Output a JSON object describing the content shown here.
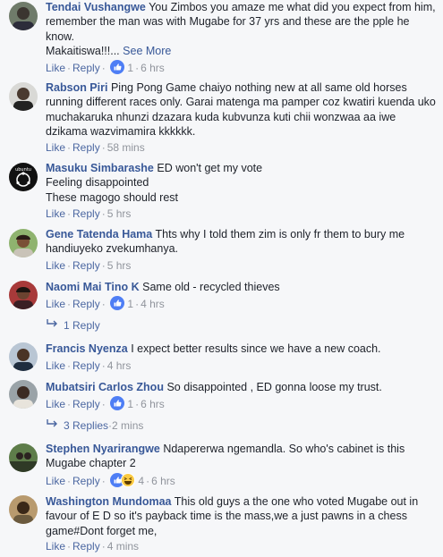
{
  "actions": {
    "like": "Like",
    "reply": "Reply",
    "sep": "·",
    "see_more": "See More"
  },
  "comments": [
    {
      "author": "Tendai Vushangwe",
      "text": "You Zimbos you amaze me what did you expect from him, remember the man was with Mugabe for 37 yrs and these are the pple he know.",
      "text2": "Makaitiswa!!!...",
      "reaction_count": "1",
      "time": "6 hrs",
      "avatar_icon": "photo-avatar-icon"
    },
    {
      "author": "Rabson Piri",
      "text": "Ping Pong Game chaiyo nothing new at all same old horses running different races only. Garai matenga ma pamper coz kwatiri kuenda uko muchakaruka nhunzi dzazara kuda kubvunza kuti chii wonzwaa aa iwe dzikama wazvimamira kkkkkk.",
      "time": "58 mins",
      "avatar_icon": "photo-avatar-icon"
    },
    {
      "author": "Masuku Simbarashe",
      "text": "ED won't get my vote",
      "text2": "Feeling disappointed",
      "text3": "These magogo should rest",
      "time": "5 hrs",
      "avatar_icon": "ubuntu-logo-icon",
      "avatar_label": "ubuntu"
    },
    {
      "author": "Gene Tatenda Hama",
      "text": "Thts why I told them zim is only fr them to bury me handiuyeko zvekumhanya.",
      "time": "5 hrs",
      "avatar_icon": "photo-avatar-icon"
    },
    {
      "author": "Naomi Mai Tino K",
      "text": "Same old - recycled thieves",
      "reaction_count": "1",
      "time": "4 hrs",
      "replies_label": "1 Reply",
      "avatar_icon": "photo-avatar-icon"
    },
    {
      "author": "Francis Nyenza",
      "text": "I expect better results since we have a new coach.",
      "time": "4 hrs",
      "avatar_icon": "photo-avatar-icon"
    },
    {
      "author": "Mubatsiri Carlos Zhou",
      "text": "So disappointed , ED gonna loose my trust.",
      "reaction_count": "1",
      "time": "6 hrs",
      "replies_label": "3 Replies",
      "replies_time": "2 mins",
      "avatar_icon": "photo-avatar-icon"
    },
    {
      "author": "Stephen Nyarirangwe",
      "text": "Ndapererwa ngemandla. So who's cabinet is this Mugabe chapter 2",
      "reaction_count": "4",
      "time": "6 hrs",
      "avatar_icon": "photo-avatar-icon"
    },
    {
      "author": "Washington Mundomaa",
      "text": "This old guys a the one who voted Mugabe out in favour of E D so it's payback time is the mass,we a just pawns in a chess game#Dont forget me,",
      "time": "4 mins",
      "avatar_icon": "photo-avatar-icon"
    }
  ],
  "colors": {
    "link": "#385898",
    "meta": "#90949c",
    "like_blue": "#4b67a1",
    "background": "#f6f7f9"
  }
}
